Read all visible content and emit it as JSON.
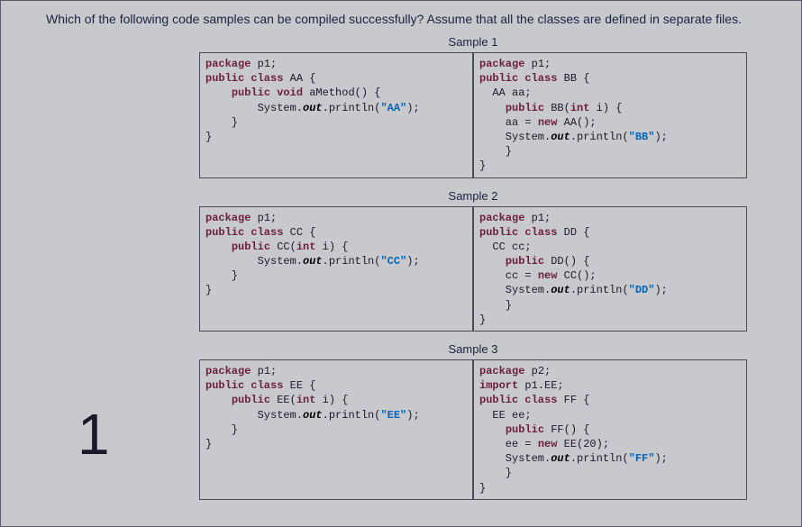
{
  "question": "Which of the following code samples can be compiled successfully? Assume that all the classes are defined in separate files.",
  "page_number": "1",
  "samples": [
    {
      "title": "Sample 1",
      "left": {
        "tokens": [
          [
            "kw",
            "package"
          ],
          [
            "txt",
            " p1;\n"
          ],
          [
            "kw",
            "public class"
          ],
          [
            "txt",
            " AA {\n    "
          ],
          [
            "kw",
            "public void"
          ],
          [
            "txt",
            " aMethod() {\n        System."
          ],
          [
            "out",
            "out"
          ],
          [
            "txt",
            ".println("
          ],
          [
            "str",
            "\"AA\""
          ],
          [
            "txt",
            ");\n    }\n}"
          ]
        ]
      },
      "right": {
        "tokens": [
          [
            "kw",
            "package"
          ],
          [
            "txt",
            " p1;\n"
          ],
          [
            "kw",
            "public class"
          ],
          [
            "txt",
            " BB {\n  AA aa;\n    "
          ],
          [
            "kw",
            "public"
          ],
          [
            "txt",
            " BB("
          ],
          [
            "kw",
            "int"
          ],
          [
            "txt",
            " i) {\n    aa = "
          ],
          [
            "kw",
            "new"
          ],
          [
            "txt",
            " AA();\n    System."
          ],
          [
            "out",
            "out"
          ],
          [
            "txt",
            ".println("
          ],
          [
            "str",
            "\"BB\""
          ],
          [
            "txt",
            ");\n    }\n}"
          ]
        ]
      }
    },
    {
      "title": "Sample 2",
      "left": {
        "tokens": [
          [
            "kw",
            "package"
          ],
          [
            "txt",
            " p1;\n"
          ],
          [
            "kw",
            "public class"
          ],
          [
            "txt",
            " CC {\n    "
          ],
          [
            "kw",
            "public"
          ],
          [
            "txt",
            " CC("
          ],
          [
            "kw",
            "int"
          ],
          [
            "txt",
            " i) {\n        System."
          ],
          [
            "out",
            "out"
          ],
          [
            "txt",
            ".println("
          ],
          [
            "str",
            "\"CC\""
          ],
          [
            "txt",
            ");\n    }\n}"
          ]
        ]
      },
      "right": {
        "tokens": [
          [
            "kw",
            "package"
          ],
          [
            "txt",
            " p1;\n"
          ],
          [
            "kw",
            "public class"
          ],
          [
            "txt",
            " DD {\n  CC cc;\n    "
          ],
          [
            "kw",
            "public"
          ],
          [
            "txt",
            " DD() {\n    cc = "
          ],
          [
            "kw",
            "new"
          ],
          [
            "txt",
            " CC();\n    System."
          ],
          [
            "out",
            "out"
          ],
          [
            "txt",
            ".println("
          ],
          [
            "str",
            "\"DD\""
          ],
          [
            "txt",
            ");\n    }\n}"
          ]
        ]
      }
    },
    {
      "title": "Sample 3",
      "left": {
        "tokens": [
          [
            "kw",
            "package"
          ],
          [
            "txt",
            " p1;\n"
          ],
          [
            "kw",
            "public class"
          ],
          [
            "txt",
            " EE {\n    "
          ],
          [
            "kw",
            "public"
          ],
          [
            "txt",
            " EE("
          ],
          [
            "kw",
            "int"
          ],
          [
            "txt",
            " i) {\n        System."
          ],
          [
            "out",
            "out"
          ],
          [
            "txt",
            ".println("
          ],
          [
            "str",
            "\"EE\""
          ],
          [
            "txt",
            ");\n    }\n}"
          ]
        ]
      },
      "right": {
        "tokens": [
          [
            "kw",
            "package"
          ],
          [
            "txt",
            " p2;\n"
          ],
          [
            "kw",
            "import"
          ],
          [
            "txt",
            " p1.EE;\n"
          ],
          [
            "kw",
            "public class"
          ],
          [
            "txt",
            " FF {\n  EE ee;\n    "
          ],
          [
            "kw",
            "public"
          ],
          [
            "txt",
            " FF() {\n    ee = "
          ],
          [
            "kw",
            "new"
          ],
          [
            "txt",
            " EE(20);\n    System."
          ],
          [
            "out",
            "out"
          ],
          [
            "txt",
            ".println("
          ],
          [
            "str",
            "\"FF\""
          ],
          [
            "txt",
            ");\n    }\n}"
          ]
        ]
      }
    }
  ]
}
